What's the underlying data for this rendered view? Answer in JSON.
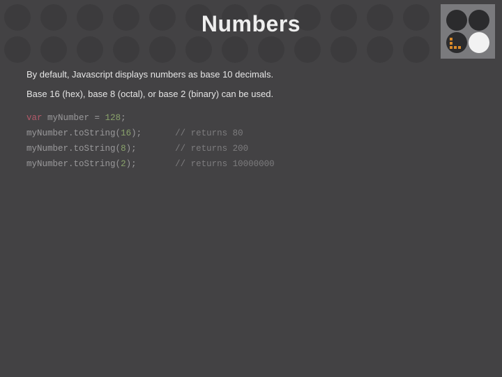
{
  "title": "Numbers",
  "paragraphs": [
    "By default, Javascript displays numbers as base 10 decimals.",
    "Base 16 (hex), base 8 (octal), or base 2 (binary) can be used."
  ],
  "code": {
    "line1": {
      "kw": "var",
      "space": " ",
      "id": "myNumber",
      "op": " = ",
      "num": "128",
      "pun": ";"
    },
    "line2": {
      "obj": "myNumber",
      "dot": ".",
      "fn": "toString",
      "open": "(",
      "arg": "16",
      "close": ");",
      "cmt": "// returns 80"
    },
    "line3": {
      "obj": "myNumber",
      "dot": ".",
      "fn": "toString",
      "open": "(",
      "arg": "8",
      "close": ");",
      "cmt": "// returns 200"
    },
    "line4": {
      "obj": "myNumber",
      "dot": ".",
      "fn": "toString",
      "open": "(",
      "arg": "2",
      "close": ");",
      "cmt": "// returns 10000000"
    }
  }
}
